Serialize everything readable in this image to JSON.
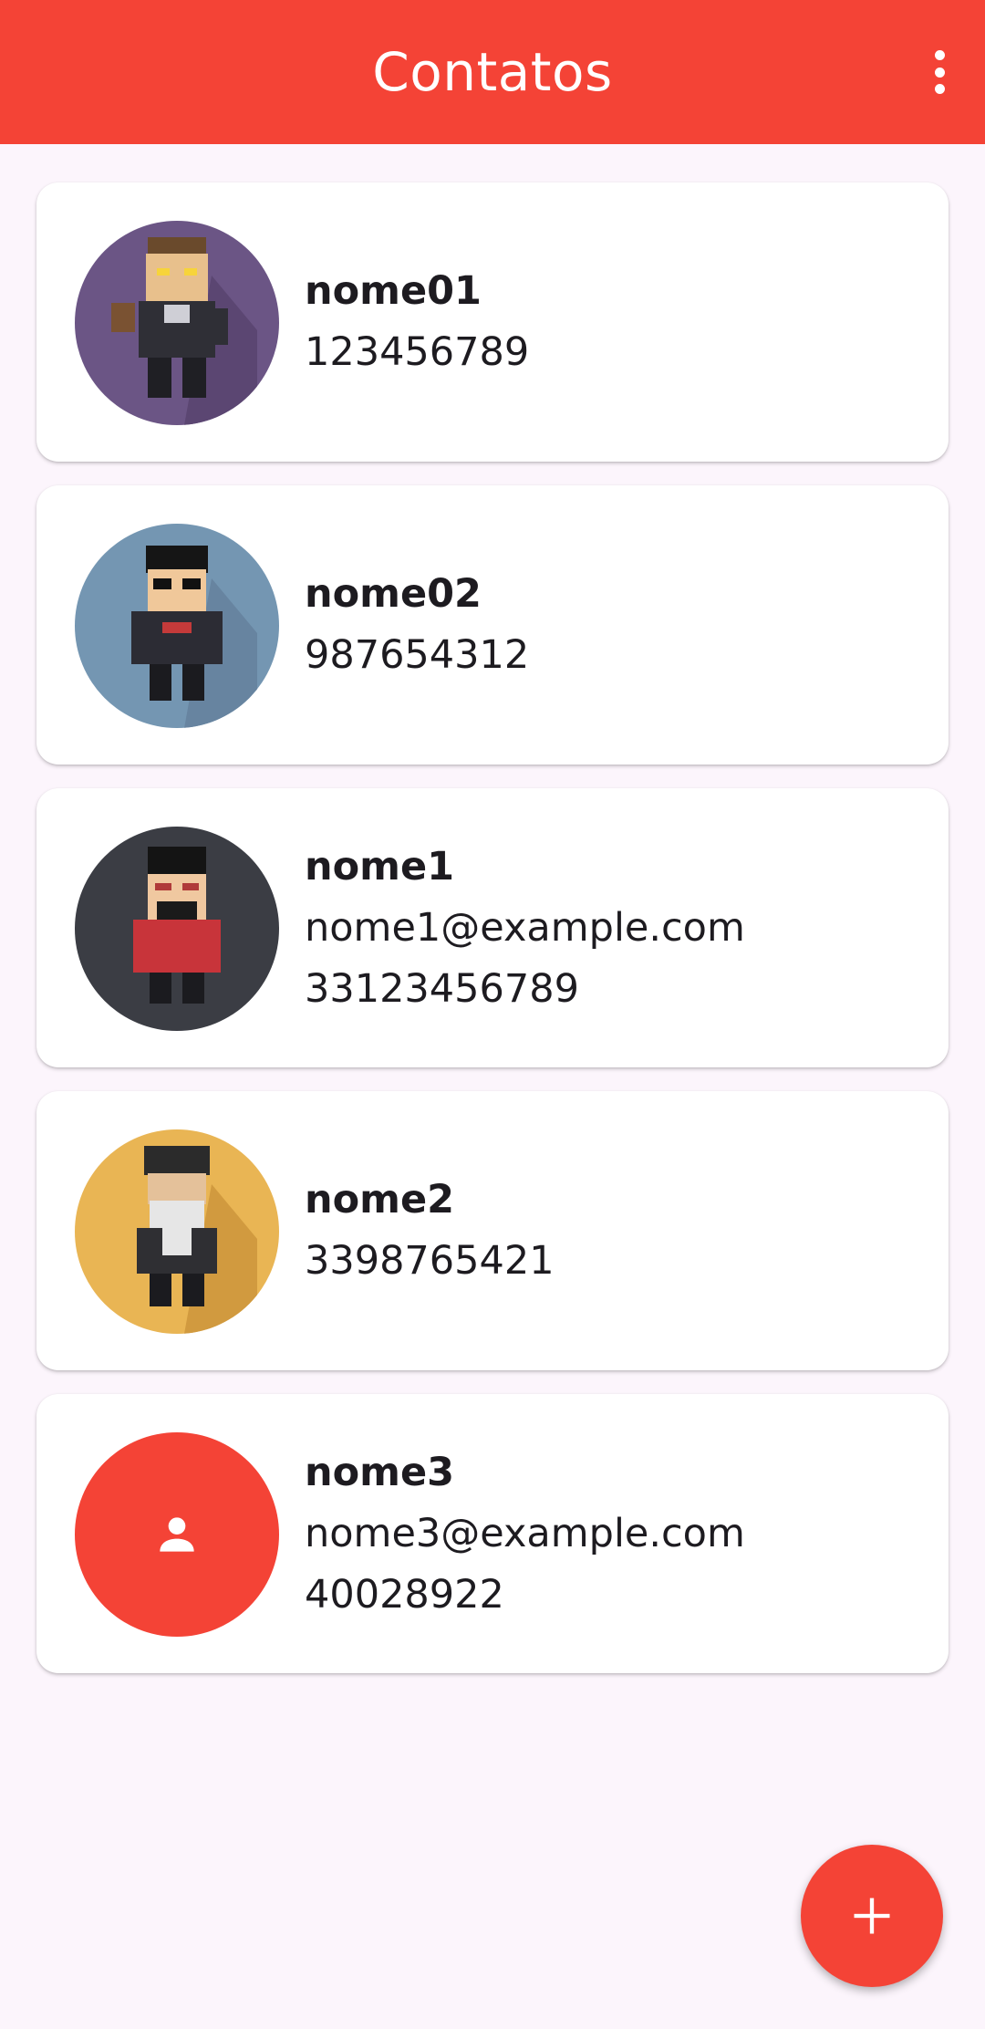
{
  "appbar": {
    "title": "Contatos",
    "menu_icon": "more-vert-icon"
  },
  "colors": {
    "primary": "#f44336",
    "background": "#fcf5fc",
    "card": "#ffffff",
    "text": "#1d1b20"
  },
  "contacts": [
    {
      "name": "nome01",
      "phone": "123456789",
      "avatar": "pixel-character-1"
    },
    {
      "name": "nome02",
      "phone": "987654312",
      "avatar": "pixel-character-2"
    },
    {
      "name": "nome1",
      "email": "nome1@example.com",
      "phone": "33123456789",
      "avatar": "pixel-character-3"
    },
    {
      "name": "nome2",
      "phone": "3398765421",
      "avatar": "pixel-character-4"
    },
    {
      "name": "nome3",
      "email": "nome3@example.com",
      "phone": "40028922",
      "avatar": "person-icon"
    }
  ],
  "fab": {
    "icon": "add-icon"
  }
}
